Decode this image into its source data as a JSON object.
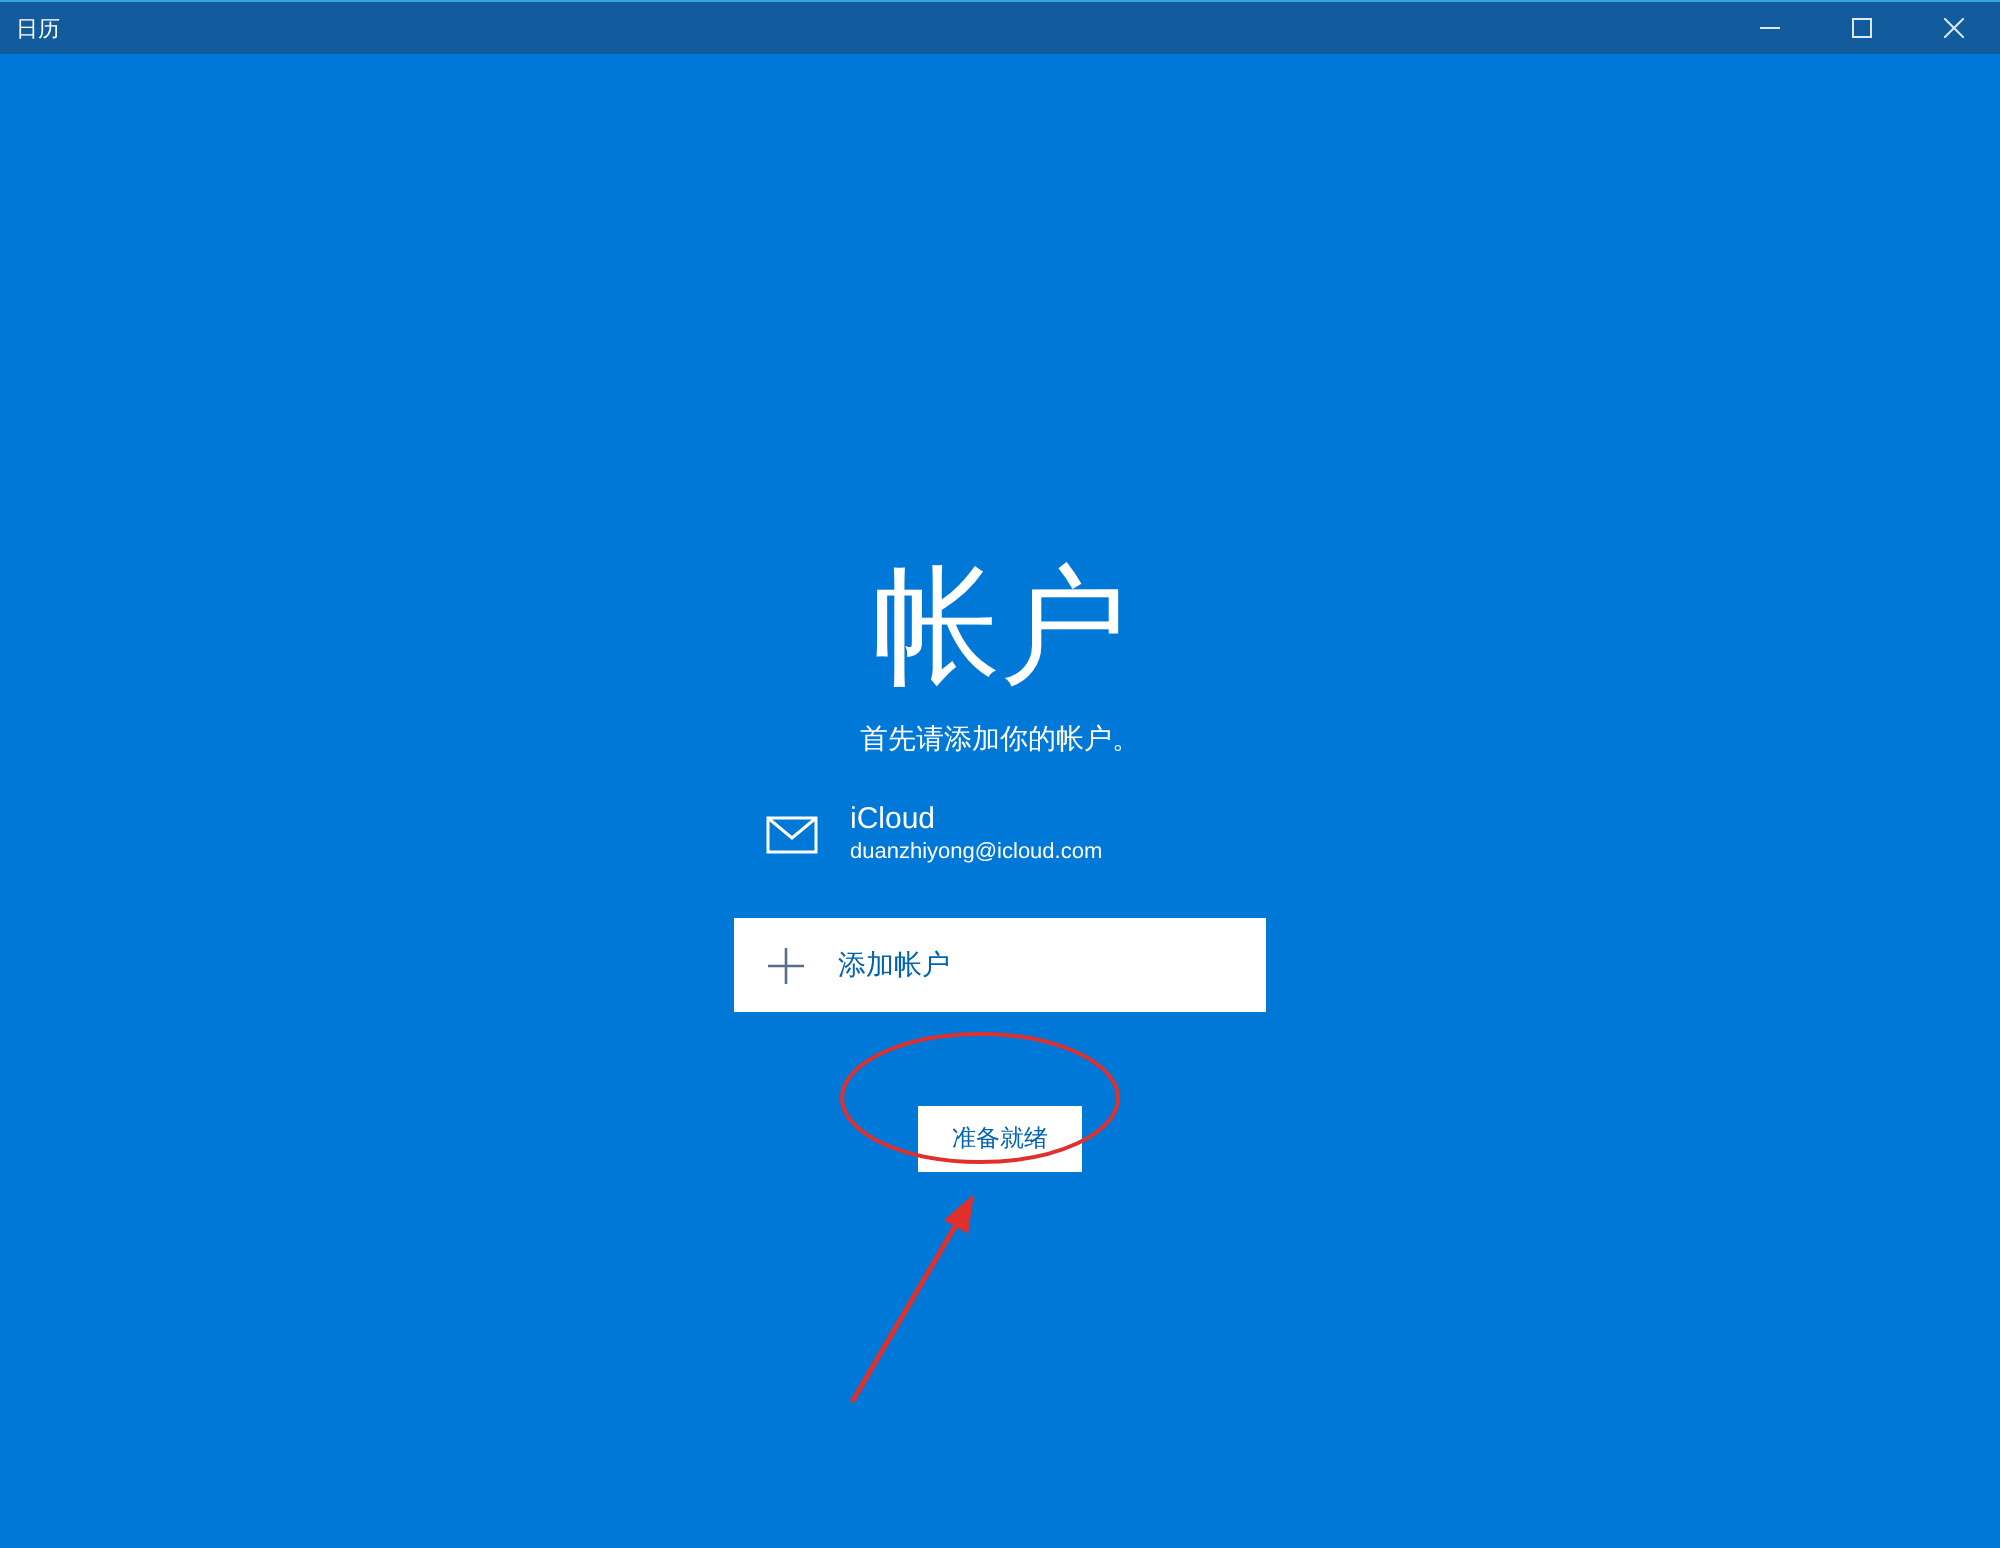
{
  "window": {
    "title": "日历"
  },
  "page": {
    "heading": "帐户",
    "subtitle": "首先请添加你的帐户。",
    "accounts": [
      {
        "name": "iCloud",
        "email": "duanzhiyong@icloud.com"
      }
    ],
    "add_button": "添加帐户",
    "ready_button": "准备就绪"
  }
}
